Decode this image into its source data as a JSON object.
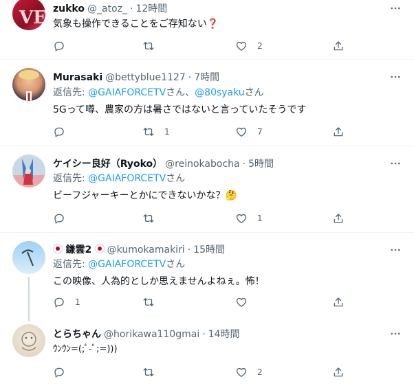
{
  "tweets": [
    {
      "name": "zukko",
      "handle": "@_atoz_",
      "time": "12時間",
      "reply_to": null,
      "text": "気象も操作できることをご存知ない",
      "text_suffix": "❓",
      "stats": {
        "reply": "",
        "retweet": "",
        "like": "2"
      }
    },
    {
      "name": "Murasaki",
      "handle": "@bettyblue1127",
      "time": "7時間",
      "reply_prefix": "返信先: ",
      "reply_link1": "@GAIAFORCETV",
      "reply_mid": "さん、",
      "reply_link2": "@80syaku",
      "reply_suffix": "さん",
      "text": "5Gって噂、農家の方は暑さではないと言っていたそうです",
      "stats": {
        "reply": "",
        "retweet": "1",
        "like": "7"
      }
    },
    {
      "name": "ケイシー良好（Ryoko）",
      "handle": "@reinokabocha",
      "time": "5時間",
      "reply_prefix": "返信先: ",
      "reply_link1": "@GAIAFORCETV",
      "reply_suffix": "さん",
      "text": "ビーフジャーキーとかにできないかな？",
      "text_suffix": "🤔",
      "stats": {
        "reply": "",
        "retweet": "",
        "like": "1"
      }
    },
    {
      "name": "鎌雲2",
      "handle": "@kumokamakiri",
      "time": "15時間",
      "reply_prefix": "返信先: ",
      "reply_link1": "@GAIAFORCETV",
      "reply_suffix": "さん",
      "text": "この映像、人為的としか思えませんよねぇ。怖！",
      "stats": {
        "reply": "1",
        "retweet": "",
        "like": ""
      }
    },
    {
      "name": "とらちゃん",
      "handle": "@horikawa110gmai",
      "time": "14時間",
      "reply_to": null,
      "text": "ｳﾝｳﾝ=(;ﾟ-ﾟ;=)))",
      "stats": {
        "reply": "",
        "retweet": "",
        "like": "2"
      }
    }
  ],
  "separator": "·",
  "icons": {
    "more": "more-horizontal-icon",
    "reply": "reply-icon",
    "retweet": "retweet-icon",
    "like": "heart-icon",
    "share": "share-icon"
  },
  "colors": {
    "link": "#1d9bf0",
    "secondary": "#536471",
    "text": "#0f1419",
    "divider": "#eff3f4",
    "thread_line": "#cfd9de"
  }
}
